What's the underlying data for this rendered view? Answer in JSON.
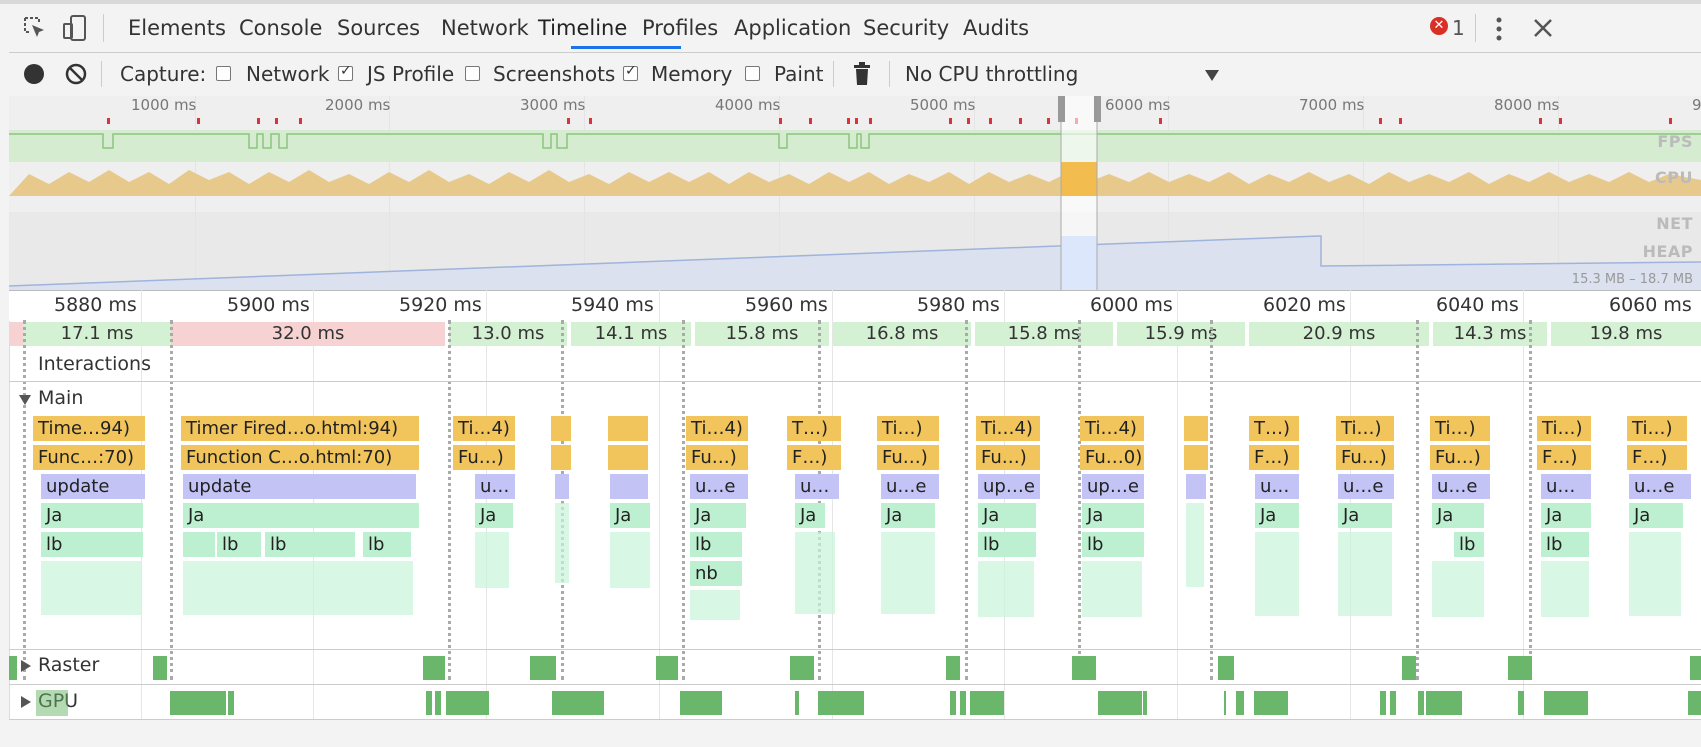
{
  "tabs": {
    "elements": "Elements",
    "console": "Console",
    "sources": "Sources",
    "network": "Network",
    "timeline": "Timeline",
    "profiles": "Profiles",
    "application": "Application",
    "security": "Security",
    "audits": "Audits"
  },
  "status": {
    "error_count": "1"
  },
  "toolbar": {
    "capture_label": "Capture:",
    "network": "Network",
    "js_profile": "JS Profile",
    "screenshots": "Screenshots",
    "memory": "Memory",
    "paint": "Paint",
    "throttling": "No CPU throttling",
    "checks": {
      "network": false,
      "js_profile": true,
      "screenshots": false,
      "memory": true,
      "paint": false
    }
  },
  "overview": {
    "ticks": [
      "1000 ms",
      "2000 ms",
      "3000 ms",
      "4000 ms",
      "5000 ms",
      "6000 ms",
      "7000 ms",
      "8000 ms",
      "9"
    ],
    "fps": "FPS",
    "cpu": "CPU",
    "net": "NET",
    "heap": "HEAP",
    "heap_range": "15.3 MB – 18.7 MB"
  },
  "ruler": [
    "5880 ms",
    "5900 ms",
    "5920 ms",
    "5940 ms",
    "5960 ms",
    "5980 ms",
    "6000 ms",
    "6020 ms",
    "6040 ms",
    "6060 ms"
  ],
  "frames": [
    "17.1 ms",
    "32.0 ms",
    "13.0 ms",
    "14.1 ms",
    "15.8 ms",
    "16.8 ms",
    "15.8 ms",
    "15.9 ms",
    "20.9 ms",
    "14.3 ms",
    "19.8 ms"
  ],
  "tracks": {
    "interactions": "Interactions",
    "main": "Main",
    "raster": "Raster",
    "gpu": "GPU"
  },
  "events": {
    "timer_first": "Time…94)",
    "func_first": "Func…:70)",
    "update_first": "update",
    "js_first": "Ja",
    "lb_first": "lb",
    "timer_2": "Timer Fired…o.html:94)",
    "func_2": "Function C…o.html:70)",
    "update_2": "update",
    "js_2": "Ja",
    "lb": "lb",
    "timer_3": "Ti…4)",
    "func_3": "Fu…)",
    "upd_3": "u…",
    "js_short": "Ja",
    "timer_4": "Ti…4)",
    "func_4": "Fu…)",
    "upd_4": "u…e",
    "nb": "nb",
    "timer_5": "T…)",
    "func_5": "F…)",
    "upd_5": "u…",
    "timer_6": "Ti…)",
    "func_6": "Fu…)",
    "upd_6": "u…e",
    "timer_7": "Ti…4)",
    "func_7": "Fu…)",
    "upd_7": "up…e",
    "timer_8": "Ti…4)",
    "func_8": "Fu…0)",
    "upd_8": "up…e",
    "timer_9": "T…)",
    "func_9": "F…)",
    "upd_9": "u…",
    "timer_10": "Ti…)",
    "func_10": "Fu…)",
    "upd_10": "u…e",
    "timer_11": "Ti…)",
    "func_11": "Fu…)",
    "upd_11": "u…e",
    "timer_12": "Ti…)",
    "func_12": "F…)",
    "upd_12": "u…",
    "timer_13": "Ti…)",
    "func_13": "F…)",
    "upd_13": "u…e"
  },
  "colors": {
    "scripting": "#f2c55c",
    "rendering": "#c4c3f5",
    "js_frames": "#bdf0d0",
    "gpu": "#6ab66a",
    "long_frame": "#f7d2d2",
    "frame": "#d4f1d4",
    "accent": "#1a73e8"
  }
}
